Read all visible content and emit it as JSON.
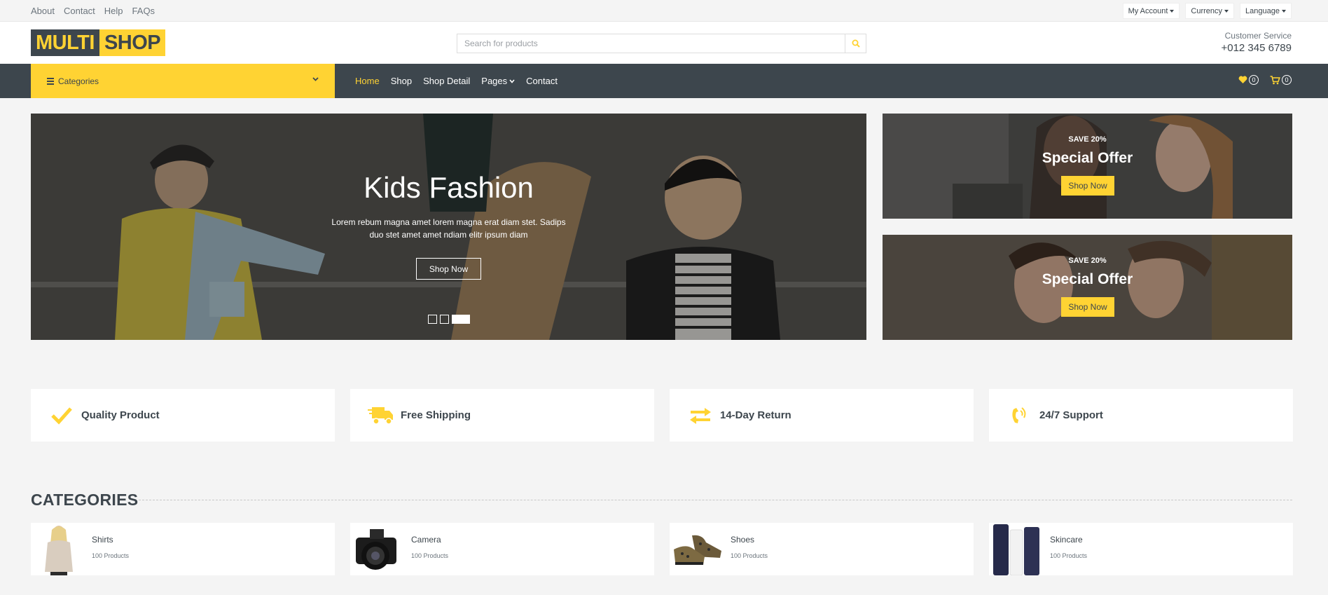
{
  "topbar": {
    "links": [
      "About",
      "Contact",
      "Help",
      "FAQs"
    ],
    "dropdowns": [
      "My Account",
      "Currency",
      "Language"
    ]
  },
  "header": {
    "logo_part1": "MULTI",
    "logo_part2": "SHOP",
    "search_placeholder": "Search for products",
    "customer_service_label": "Customer Service",
    "phone": "+012 345 6789"
  },
  "navbar": {
    "categories_label": "Categories",
    "links": [
      "Home",
      "Shop",
      "Shop Detail",
      "Pages",
      "Contact"
    ],
    "active_link": "Home",
    "wishlist_count": "0",
    "cart_count": "0"
  },
  "hero": {
    "title": "Kids Fashion",
    "text": "Lorem rebum magna amet lorem magna erat diam stet. Sadips duo stet amet amet ndiam elitr ipsum diam",
    "button": "Shop Now",
    "slides": 3,
    "active_slide": 3
  },
  "offers": [
    {
      "save": "SAVE 20%",
      "title": "Special Offer",
      "button": "Shop Now"
    },
    {
      "save": "SAVE 20%",
      "title": "Special Offer",
      "button": "Shop Now"
    }
  ],
  "features": [
    {
      "label": "Quality Product",
      "icon": "check-icon"
    },
    {
      "label": "Free Shipping",
      "icon": "shipping-truck-icon"
    },
    {
      "label": "14-Day Return",
      "icon": "exchange-arrows-icon"
    },
    {
      "label": "24/7 Support",
      "icon": "phone-volume-icon"
    }
  ],
  "categories_section": {
    "title": "CATEGORIES",
    "items": [
      {
        "name": "Shirts",
        "count": "100 Products"
      },
      {
        "name": "Camera",
        "count": "100 Products"
      },
      {
        "name": "Shoes",
        "count": "100 Products"
      },
      {
        "name": "Skincare",
        "count": "100 Products"
      }
    ]
  },
  "colors": {
    "primary": "#ffd333",
    "dark": "#3d464d",
    "background": "#f4f4f4"
  }
}
